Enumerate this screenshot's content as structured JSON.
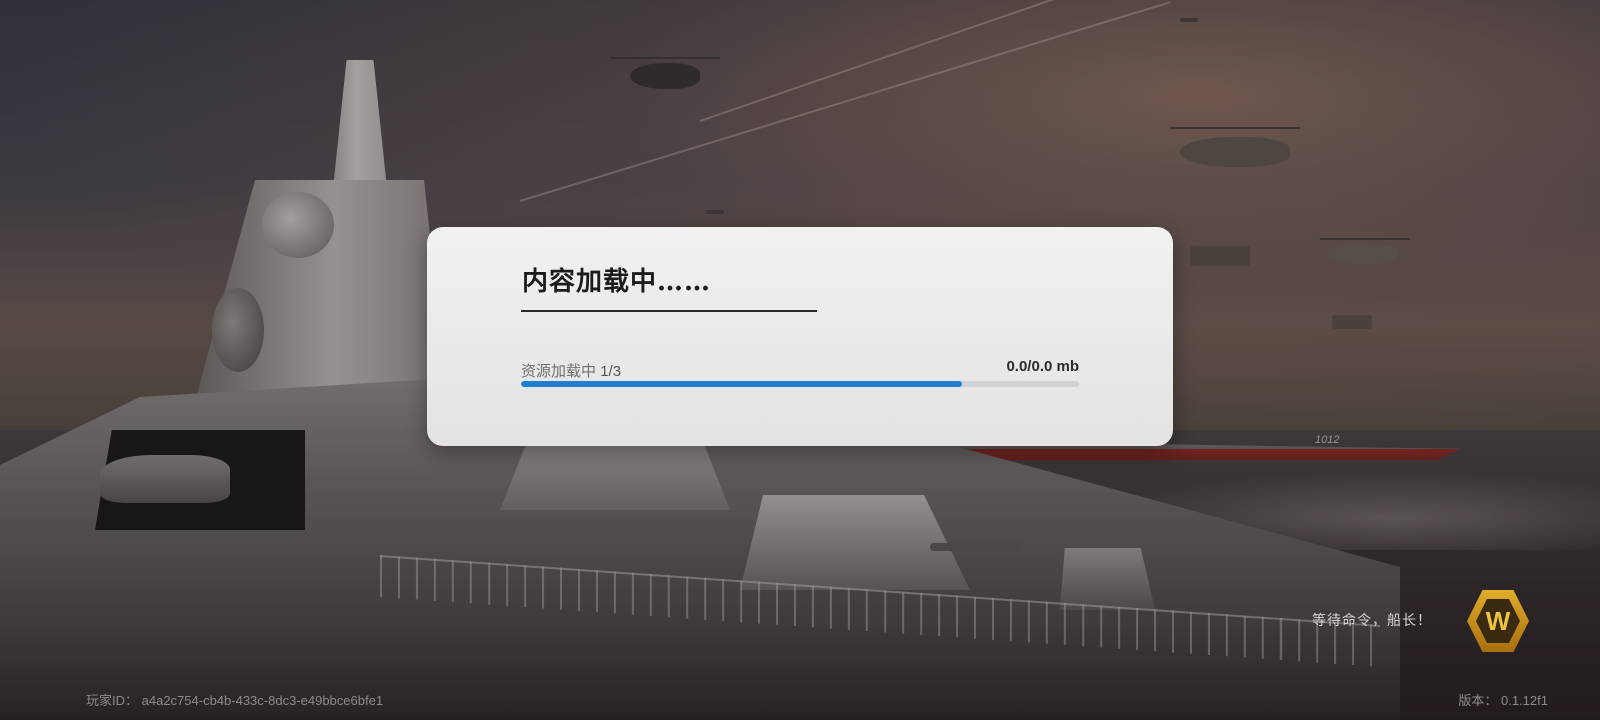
{
  "dialog": {
    "title": "内容加载中……",
    "resource_label": "资源加载中",
    "resource_count": "1/3",
    "size_text": "0.0/0.0 mb",
    "progress": 0.79
  },
  "hud": {
    "status_text": "等待命令，船长！",
    "player_id_label": "玩家ID：",
    "player_id": "a4a2c754-cb4b-433c-8dc3-e49bbce6bfe1",
    "version_label": "版本：",
    "version": "0.1.12f1",
    "logo_letter": "W"
  },
  "colors": {
    "progress_fill": "#1a7fd6",
    "progress_track": "#d2d2d2",
    "logo_gold": "#e0ad2c"
  },
  "scene": {
    "far_ship_hull_number": "1012"
  }
}
